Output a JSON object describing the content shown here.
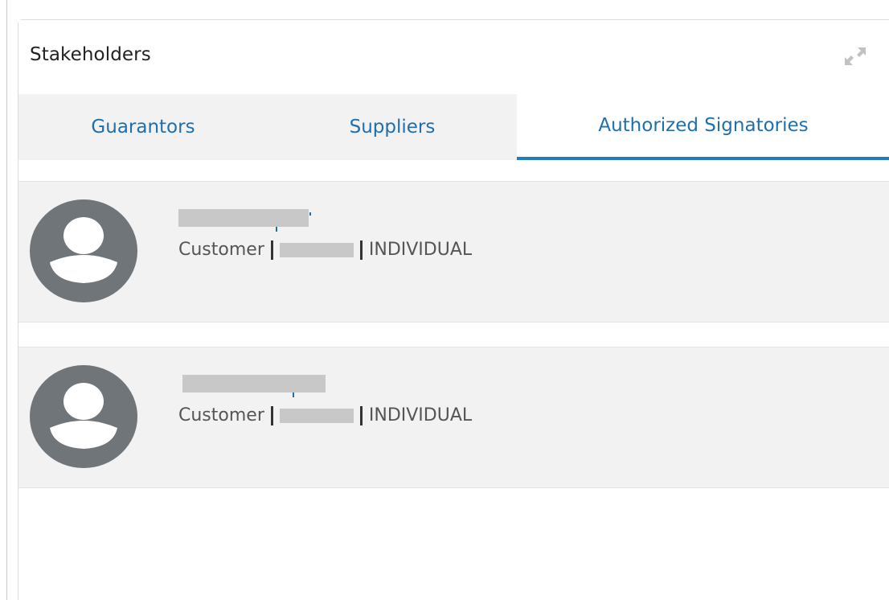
{
  "panel": {
    "title": "Stakeholders",
    "expand_icon": "expand-arrows-icon"
  },
  "tabs": [
    {
      "label": "Guarantors",
      "active": false
    },
    {
      "label": "Suppliers",
      "active": false
    },
    {
      "label": "Authorized Signatories",
      "active": true
    }
  ],
  "signatories": [
    {
      "role": "Customer",
      "type": "INDIVIDUAL",
      "avatar_icon": "user-avatar-icon"
    },
    {
      "role": "Customer",
      "type": "INDIVIDUAL",
      "avatar_icon": "user-avatar-icon"
    }
  ],
  "colors": {
    "accent": "#1f7dc0",
    "tab_text": "#1f6fae",
    "avatar": "#707579",
    "card_bg": "#f2f2f2"
  }
}
